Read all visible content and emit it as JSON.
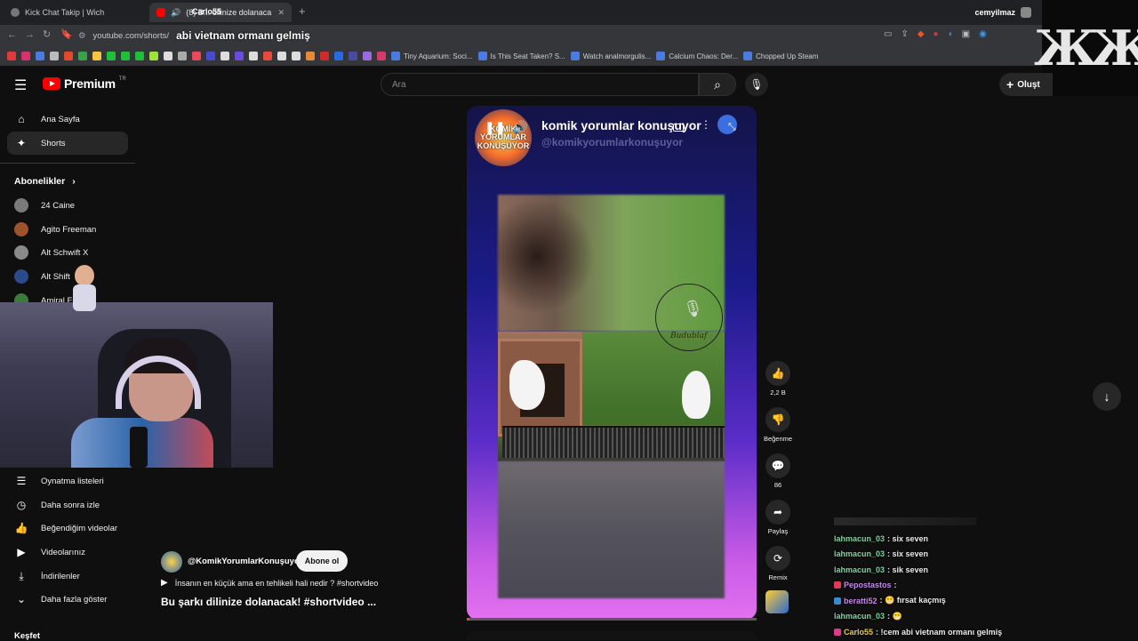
{
  "browser": {
    "tabs": [
      {
        "title": "Kick Chat Takip | Wich"
      },
      {
        "title": "(8) B... dilinize dolanaca"
      }
    ],
    "tab_overlay": "Carlo55",
    "new_tab": "+",
    "url": "youtube.com/shorts/",
    "url_overlay": "abi vietnam ormanı gelmiş",
    "profile_name": "cemyilmaz",
    "bookmarks": [
      {
        "label": "Tiny Aquarium: Soci..."
      },
      {
        "label": "Is This Seat Taken? S..."
      },
      {
        "label": "Watch analmorgulis..."
      },
      {
        "label": "Calcium Chaos: Der..."
      },
      {
        "label": "Chopped Up Steam"
      }
    ],
    "bookmark_icon_colors": [
      "#e03a3a",
      "#d6336c",
      "#4a7be0",
      "#bbbbbb",
      "#e34a2a",
      "#3aa34a",
      "#f4c542",
      "#1fbf3c",
      "#1fbf3c",
      "#1fbf3c",
      "#9fe23a",
      "#dddddd",
      "#aaaaaa",
      "#e84a5a",
      "#4a4ad0",
      "#dddddd",
      "#6a4ae0",
      "#dddddd",
      "#e84a3a",
      "#dddddd",
      "#dddddd",
      "#e8893a",
      "#d02a2a",
      "#2a6ae0",
      "#4a4aa0",
      "#9a6ae0",
      "#d63a6a"
    ]
  },
  "brand_logo": "ЖЖ",
  "youtube": {
    "logo_text": "Premium",
    "logo_region": "TR",
    "search_placeholder": "Ara",
    "create_label": "Oluşt"
  },
  "sidebar": {
    "main": [
      {
        "label": "Ana Sayfa",
        "icon": "home-icon",
        "glyph": "⌂"
      },
      {
        "label": "Shorts",
        "icon": "shorts-icon",
        "glyph": "✦"
      }
    ],
    "subs_title": "Abonelikler",
    "subs_chevron": "›",
    "subscriptions": [
      {
        "label": "24 Caine",
        "color": "#7a7a7a"
      },
      {
        "label": "Agito Freeman",
        "color": "#a0522d"
      },
      {
        "label": "Alt Schwift X",
        "color": "#8a8a8a"
      },
      {
        "label": "Alt Shift",
        "color": "#2a4a8a"
      },
      {
        "label": "Amiral F...tu",
        "color": "#3a7a3a"
      }
    ],
    "library": [
      {
        "label": "Oynatma listeleri",
        "icon": "playlist-icon",
        "glyph": "☰"
      },
      {
        "label": "Daha sonra izle",
        "icon": "watch-later-icon",
        "glyph": "◷"
      },
      {
        "label": "Beğendiğim videolar",
        "icon": "like-icon",
        "glyph": "👍"
      },
      {
        "label": "Videolarınız",
        "icon": "your-videos-icon",
        "glyph": "▶"
      },
      {
        "label": "İndirilenler",
        "icon": "download-icon",
        "glyph": "⤓"
      },
      {
        "label": "Daha fazla göster",
        "icon": "chevron-down-icon",
        "glyph": "⌄"
      }
    ],
    "explore": "Keşfet"
  },
  "player": {
    "badge_text": "KOMİK YORUMLAR KONUŞUYOR",
    "channel_title": "komik yorumlar konuşuyor",
    "handle": "@komikyorumlarkonuşuyor",
    "watermark": "Budublaf",
    "progress": 0.01
  },
  "actions": [
    {
      "name": "like",
      "glyph": "👍",
      "label": "2,2 B"
    },
    {
      "name": "dislike",
      "glyph": "👎",
      "label": "Beğenme"
    },
    {
      "name": "comments",
      "glyph": "💬",
      "label": "86"
    },
    {
      "name": "share",
      "glyph": "➦",
      "label": "Paylaş"
    },
    {
      "name": "remix",
      "glyph": "⟳",
      "label": "Remix"
    }
  ],
  "video_info": {
    "channel": "@KomikYorumlarKonuşuyor",
    "subscribe": "Abone ol",
    "music": "İnsanın en küçük ama en tehlikeli hali nedir ? #shortvideo",
    "title": "Bu şarkı dilinize dolanacak! #shortvideo ..."
  },
  "chat": [
    {
      "user": "lahmacun_03",
      "color": "#7fd0a0",
      "text": ": six seven",
      "badge": ""
    },
    {
      "user": "lahmacun_03",
      "color": "#7fd0a0",
      "text": ": six seven",
      "badge": ""
    },
    {
      "user": "lahmacun_03",
      "color": "#7fd0a0",
      "text": ": sik seven",
      "badge": ""
    },
    {
      "user": "Pepostastos",
      "color": "#c48ae8",
      "text": ":",
      "badge": "#e03a5a"
    },
    {
      "user": "beratti52",
      "color": "#c48ae8",
      "text": ": 😬 fırsat kaçmış",
      "badge": "#3a8ad0"
    },
    {
      "user": "lahmacun_03",
      "color": "#7fd0a0",
      "text": ": 😁",
      "badge": ""
    },
    {
      "user": "Carlo55",
      "color": "#e8c84a",
      "text": ": !cem abi vietnam ormanı gelmiş",
      "badge": "#e03a8a"
    }
  ],
  "colors": {
    "yt_red": "#ff0000",
    "background": "#0f0f0f",
    "player_gradient_top": "#141448",
    "player_gradient_bottom": "#e371ef"
  }
}
